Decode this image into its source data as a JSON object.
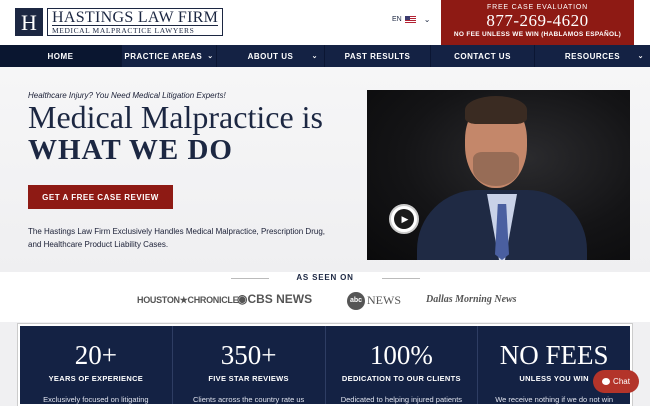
{
  "header": {
    "logo_letter": "H",
    "logo_name": "HASTINGS LAW FIRM",
    "logo_sub": "MEDICAL MALPRACTICE LAWYERS",
    "lang": "EN",
    "cta_top": "FREE CASE EVALUATION",
    "cta_phone": "877-269-4620",
    "cta_bottom": "NO FEE UNLESS WE WIN (HABLAMOS ESPAÑOL)"
  },
  "nav": [
    {
      "label": "HOME",
      "active": true,
      "dropdown": false
    },
    {
      "label": "PRACTICE AREAS",
      "active": false,
      "dropdown": true
    },
    {
      "label": "ABOUT US",
      "active": false,
      "dropdown": true
    },
    {
      "label": "PAST RESULTS",
      "active": false,
      "dropdown": false
    },
    {
      "label": "CONTACT US",
      "active": false,
      "dropdown": false
    },
    {
      "label": "RESOURCES",
      "active": false,
      "dropdown": true
    }
  ],
  "hero": {
    "tagline": "Healthcare Injury? You Need Medical Litigation Experts!",
    "headline": "Medical Malpractice is",
    "headline_strong": "WHAT WE DO",
    "button": "GET A FREE CASE REVIEW",
    "description": "The Hastings Law Firm Exclusively Handles Medical Malpractice, Prescription Drug, and Healthcare Product Liability Cases."
  },
  "seen_on": {
    "title": "AS SEEN ON",
    "outlets": {
      "houston": "HOUSTON★CHRONICLE",
      "cbs": "◉CBS NEWS",
      "abc_badge": "abc",
      "abc": "NEWS",
      "dallas": "Dallas Morning News"
    }
  },
  "stats": [
    {
      "num": "20+",
      "label": "YEARS OF EXPERIENCE",
      "desc": "Exclusively focused on litigating"
    },
    {
      "num": "350+",
      "label": "FIVE STAR REVIEWS",
      "desc": "Clients across the country rate us"
    },
    {
      "num": "100%",
      "label": "DEDICATION TO OUR CLIENTS",
      "desc": "Dedicated to helping injured patients"
    },
    {
      "num": "NO FEES",
      "label": "UNLESS YOU WIN",
      "desc": "We receive nothing if we do not win"
    }
  ],
  "chat": {
    "label": "Chat"
  },
  "colors": {
    "navy": "#142244",
    "accent_red": "#8e1a14"
  }
}
